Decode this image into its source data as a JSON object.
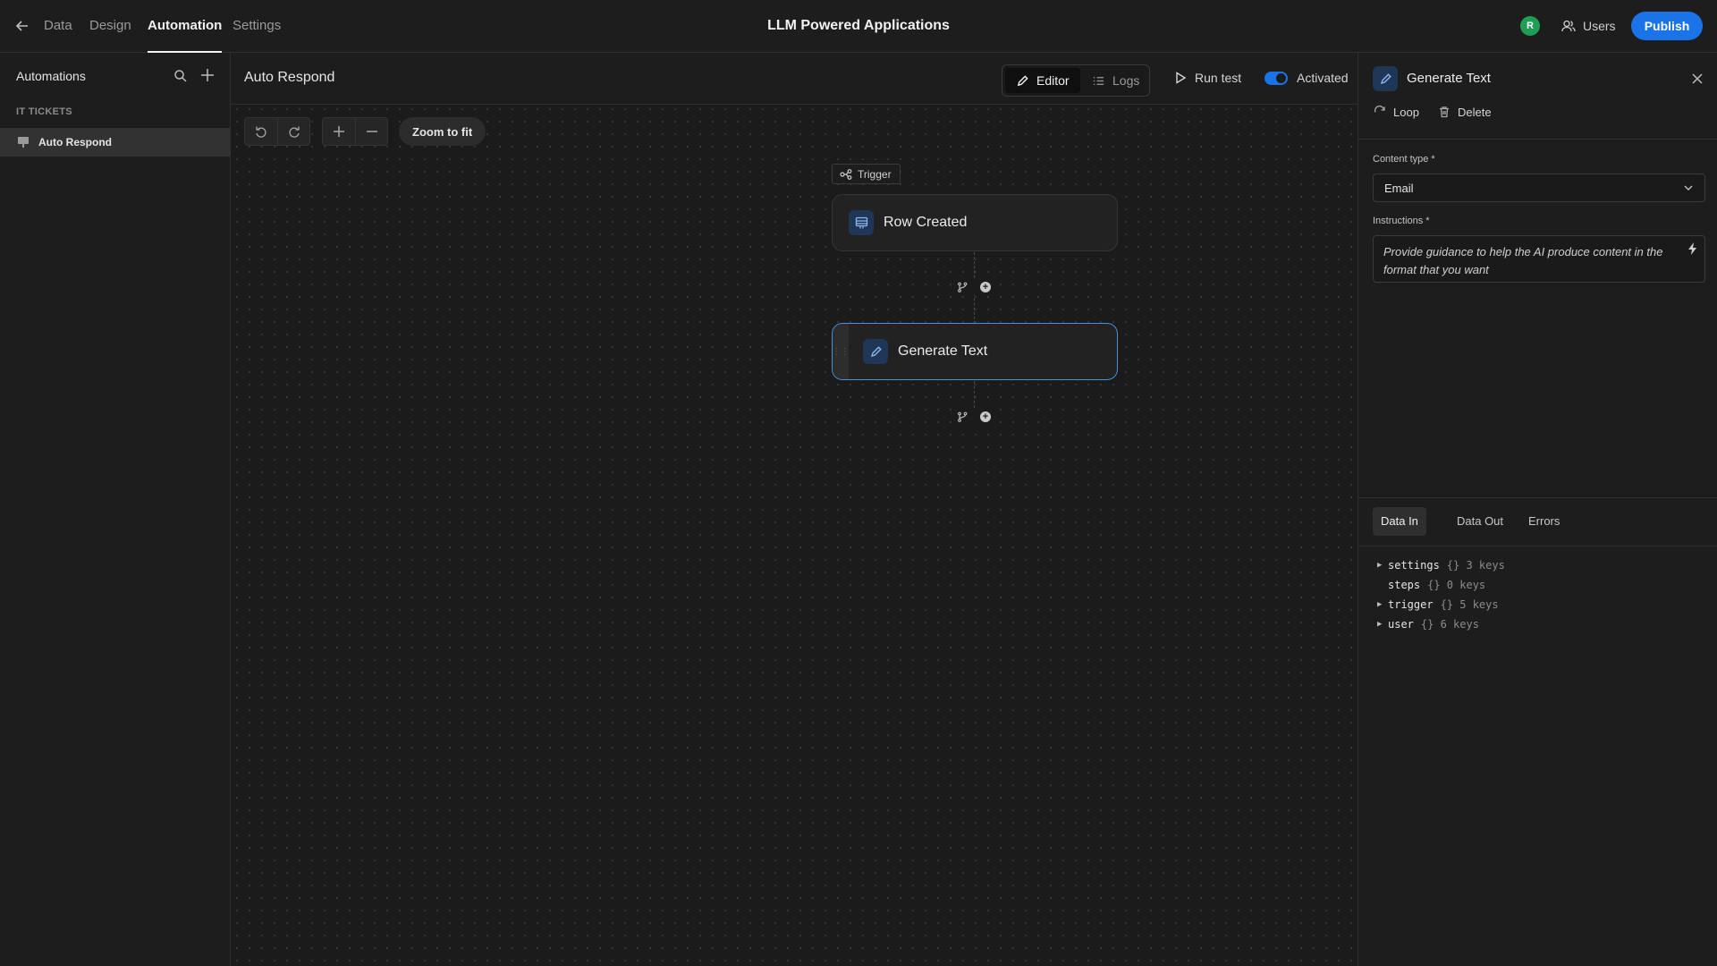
{
  "nav": {
    "tabs": [
      {
        "label": "Data"
      },
      {
        "label": "Design"
      },
      {
        "label": "Automation"
      },
      {
        "label": "Settings"
      }
    ],
    "app_title": "LLM Powered Applications",
    "avatar_initial": "R",
    "users_label": "Users",
    "publish_label": "Publish"
  },
  "sidebar": {
    "title": "Automations",
    "group": "IT TICKETS",
    "items": [
      {
        "label": "Auto Respond"
      }
    ]
  },
  "header": {
    "flow_name": "Auto Respond",
    "editor_label": "Editor",
    "logs_label": "Logs",
    "run_test_label": "Run test",
    "activated_label": "Activated",
    "activated": true
  },
  "toolbar": {
    "zoom_fit_label": "Zoom to fit"
  },
  "canvas": {
    "trigger_tag": "Trigger",
    "nodes": [
      {
        "label": "Row Created",
        "icon": "table-row-icon"
      },
      {
        "label": "Generate Text",
        "icon": "pencil-icon"
      }
    ]
  },
  "panel": {
    "title": "Generate Text",
    "loop_label": "Loop",
    "delete_label": "Delete",
    "content_type_label": "Content type *",
    "content_type_value": "Email",
    "instructions_label": "Instructions *",
    "instructions_placeholder": "Provide guidance to help the AI produce content in the format that you want",
    "tabs": [
      {
        "label": "Data In"
      },
      {
        "label": "Data Out"
      },
      {
        "label": "Errors"
      }
    ],
    "tree": [
      {
        "key": "settings",
        "meta": "{} 3 keys",
        "expandable": true
      },
      {
        "key": "steps",
        "meta": "{} 0 keys",
        "expandable": false
      },
      {
        "key": "trigger",
        "meta": "{} 5 keys",
        "expandable": true
      },
      {
        "key": "user",
        "meta": "{} 6 keys",
        "expandable": true
      }
    ]
  },
  "colors": {
    "accent": "#1b73e8",
    "avatar": "#1f9d55",
    "selected_border": "#4a8fe0"
  }
}
